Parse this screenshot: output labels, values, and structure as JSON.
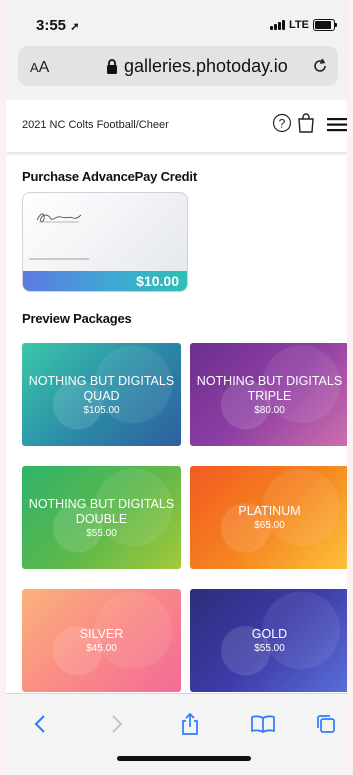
{
  "status_bar": {
    "time": "3:55",
    "network": "LTE"
  },
  "address_bar": {
    "aa_label_small": "A",
    "aa_label_large": "A",
    "url": "galleries.photoday.io"
  },
  "header": {
    "title": "2021 NC Colts Football/Cheer"
  },
  "advancepay": {
    "heading": "Purchase AdvancePay Credit",
    "price": "$10.00"
  },
  "packages": {
    "heading": "Preview Packages",
    "items": [
      {
        "name_line1": "NOTHING BUT DIGITALS",
        "name_line2": "QUAD",
        "price": "$105.00"
      },
      {
        "name_line1": "NOTHING BUT DIGITALS",
        "name_line2": "TRIPLE",
        "price": "$80.00"
      },
      {
        "name_line1": "NOTHING BUT DIGITALS",
        "name_line2": "DOUBLE",
        "price": "$55.00"
      },
      {
        "name_line1": "PLATINUM",
        "name_line2": "",
        "price": "$65.00"
      },
      {
        "name_line1": "SILVER",
        "name_line2": "",
        "price": "$45.00"
      },
      {
        "name_line1": "GOLD",
        "name_line2": "",
        "price": "$55.00"
      }
    ]
  },
  "colors": {
    "accent_blue": "#2f7bf6",
    "package_quad": "#2a8fa8",
    "package_triple": "#8e3fa3",
    "package_double": "#5fb84a",
    "package_platinum": "#f5831f",
    "package_silver": "#fa7a8c",
    "package_gold": "#3d3ba8"
  }
}
